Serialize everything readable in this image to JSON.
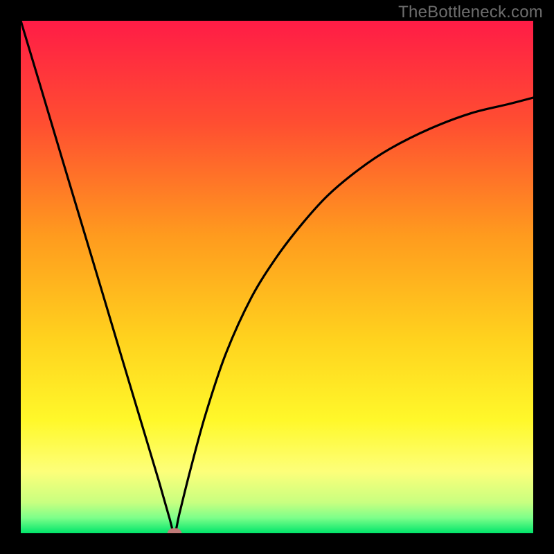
{
  "watermark": "TheBottleneck.com",
  "chart_data": {
    "type": "line",
    "title": "",
    "xlabel": "",
    "ylabel": "",
    "xlim": [
      0,
      100
    ],
    "ylim": [
      0,
      100
    ],
    "x_min_at": 30,
    "annotations": [
      {
        "x": 30,
        "y": 0,
        "note": "minimum marker (ellipse)"
      }
    ],
    "series": [
      {
        "name": "curve",
        "x": [
          0,
          4,
          8,
          12,
          16,
          20,
          24,
          27,
          29,
          30,
          31,
          33,
          36,
          40,
          45,
          50,
          55,
          60,
          66,
          72,
          80,
          88,
          95,
          100
        ],
        "y": [
          100,
          86.7,
          73.3,
          60.0,
          46.7,
          33.3,
          20.0,
          10.0,
          3.0,
          0.0,
          4.0,
          12.0,
          23.0,
          35.0,
          46.0,
          54.0,
          60.5,
          66.0,
          71.0,
          75.0,
          79.0,
          82.0,
          83.7,
          85.0
        ]
      }
    ],
    "background_gradient": {
      "stops": [
        {
          "offset": 0.0,
          "color": "#ff1c46"
        },
        {
          "offset": 0.2,
          "color": "#ff4e31"
        },
        {
          "offset": 0.42,
          "color": "#ff9b1e"
        },
        {
          "offset": 0.62,
          "color": "#ffd21e"
        },
        {
          "offset": 0.78,
          "color": "#fff82a"
        },
        {
          "offset": 0.88,
          "color": "#fdff7a"
        },
        {
          "offset": 0.94,
          "color": "#c8ff80"
        },
        {
          "offset": 0.97,
          "color": "#7dff8a"
        },
        {
          "offset": 1.0,
          "color": "#00e56a"
        }
      ]
    },
    "marker": {
      "cx": 30,
      "cy": 0,
      "rx": 1.4,
      "ry": 1.0,
      "fill": "#c07a78"
    }
  }
}
